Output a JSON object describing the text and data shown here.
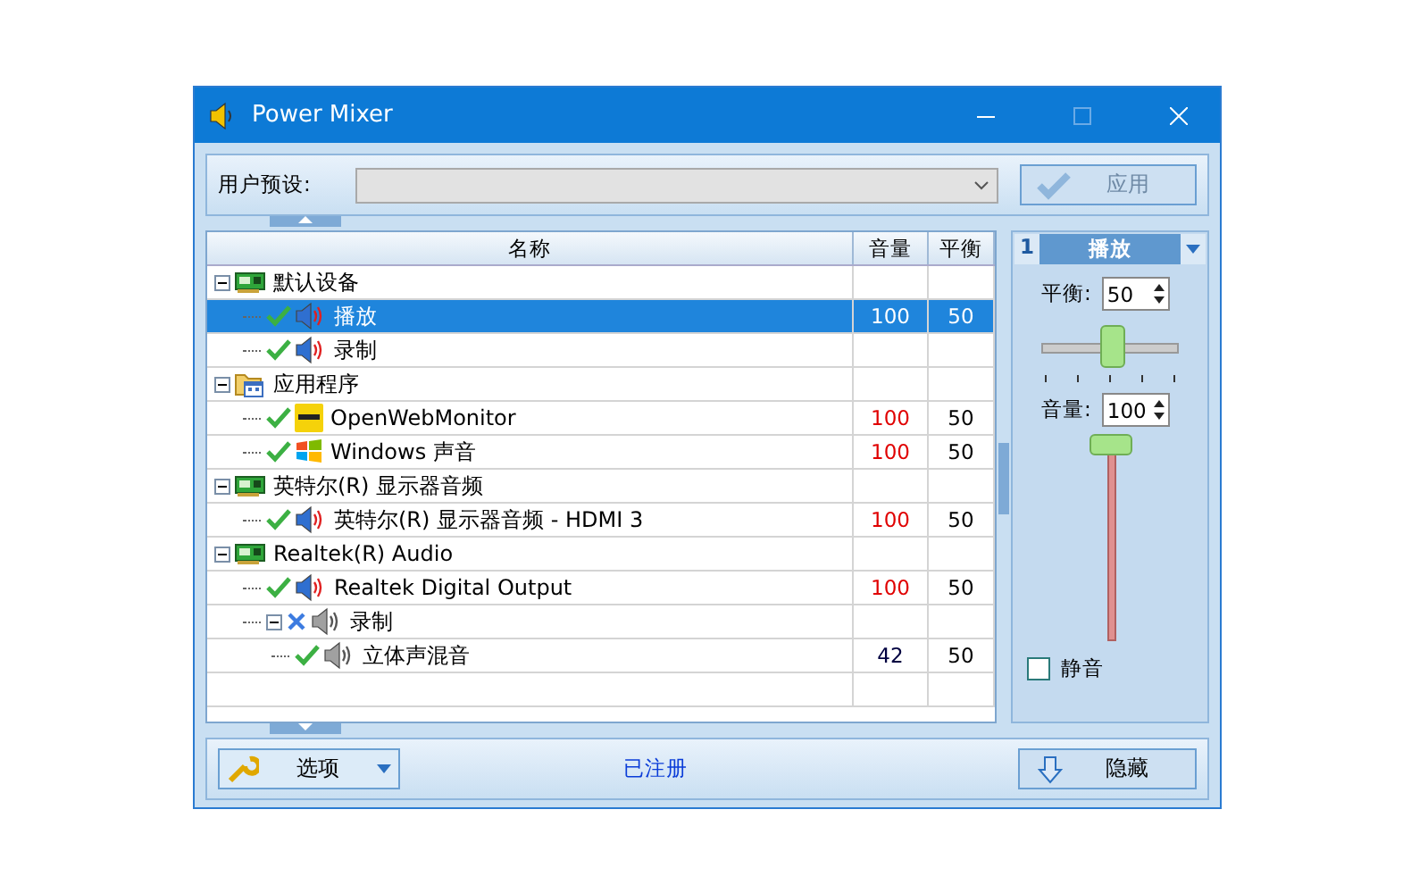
{
  "window": {
    "title": "Power Mixer"
  },
  "preset": {
    "label": "用户预设:",
    "apply_button": "应用",
    "disabled": true
  },
  "tree": {
    "columns": [
      "名称",
      "音量",
      "平衡"
    ],
    "items": [
      {
        "kind": "device",
        "label": "默认设备",
        "expanded": true,
        "children": [
          {
            "kind": "speaker",
            "label": "播放",
            "checked": true,
            "selected": true,
            "active": true,
            "volume": "100",
            "color": "#ffffff",
            "balance": "50"
          },
          {
            "kind": "speaker",
            "label": "录制",
            "checked": true,
            "selected": false,
            "active": true
          }
        ]
      },
      {
        "kind": "folder",
        "label": "应用程序",
        "expanded": true,
        "children": [
          {
            "kind": "app-yellow",
            "label": "OpenWebMonitor",
            "checked": true,
            "selected": false,
            "volume": "100",
            "color": "#e00000",
            "balance": "50"
          },
          {
            "kind": "app-windows",
            "label": "Windows 声音",
            "checked": true,
            "selected": false,
            "volume": "100",
            "color": "#e00000",
            "balance": "50"
          }
        ]
      },
      {
        "kind": "device",
        "label": "英特尔(R) 显示器音频",
        "expanded": true,
        "children": [
          {
            "kind": "speaker",
            "label": "英特尔(R) 显示器音频 - HDMI 3",
            "checked": true,
            "selected": false,
            "active": true,
            "volume": "100",
            "color": "#e00000",
            "balance": "50"
          }
        ]
      },
      {
        "kind": "device",
        "label": "Realtek(R) Audio",
        "expanded": true,
        "children": [
          {
            "kind": "speaker",
            "label": "Realtek Digital Output",
            "checked": true,
            "selected": false,
            "active": true,
            "volume": "100",
            "color": "#e00000",
            "balance": "50"
          },
          {
            "kind": "speaker",
            "label": "录制",
            "checked": false,
            "selected": false,
            "active": false,
            "expanded": true,
            "children": [
              {
                "kind": "speaker",
                "label": "立体声混音",
                "checked": true,
                "selected": false,
                "active": false,
                "volume": "42",
                "color": "#000040",
                "balance": "50"
              }
            ]
          }
        ]
      }
    ]
  },
  "panel": {
    "number": "1",
    "title": "播放",
    "balance_label": "平衡:",
    "balance_value": "50",
    "balance_slider": {
      "level": 0.5
    },
    "volume_label": "音量:",
    "volume_value": "100",
    "volume_slider": {
      "level": 1.0
    },
    "mute_label": "静音",
    "mute_checked": false
  },
  "bottom": {
    "options_button": "选项",
    "status": "已注册",
    "hide_button": "隐藏"
  }
}
